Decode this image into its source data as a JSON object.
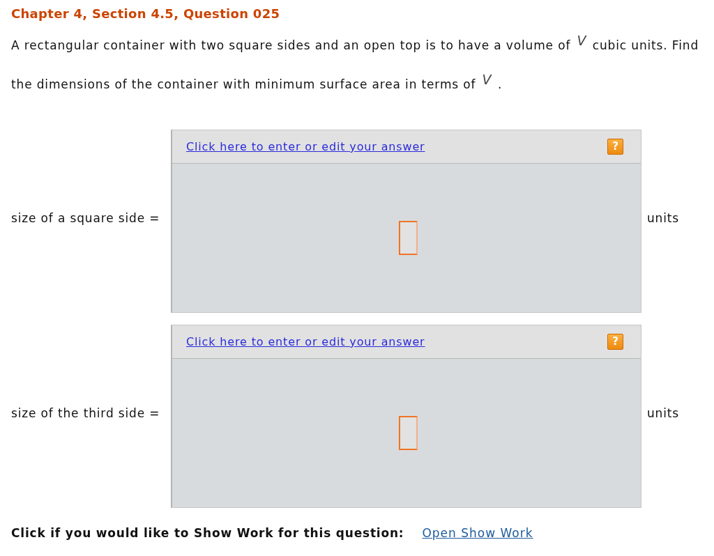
{
  "title": "Chapter 4, Section 4.5, Question 025",
  "question": [
    {
      "kind": "text",
      "text": "A rectangular container with two square sides and an open top is to have a volume of"
    },
    {
      "kind": "variable",
      "text": "V"
    },
    {
      "kind": "text",
      "text": "cubic units. Find the dimensions of the container with minimum surface area in terms of"
    },
    {
      "kind": "variable",
      "text": "V"
    },
    {
      "kind": "text",
      "text": "."
    }
  ],
  "answers": [
    {
      "label": "size of a square side =",
      "link": "Click here to enter or edit your answer",
      "help": "?",
      "units": "units"
    },
    {
      "label": "size of the third side =",
      "link": "Click here to enter or edit your answer",
      "help": "?",
      "units": "units"
    }
  ],
  "show_work": {
    "prompt": "Click if you would like to Show Work for this question:",
    "link": "Open Show Work"
  }
}
